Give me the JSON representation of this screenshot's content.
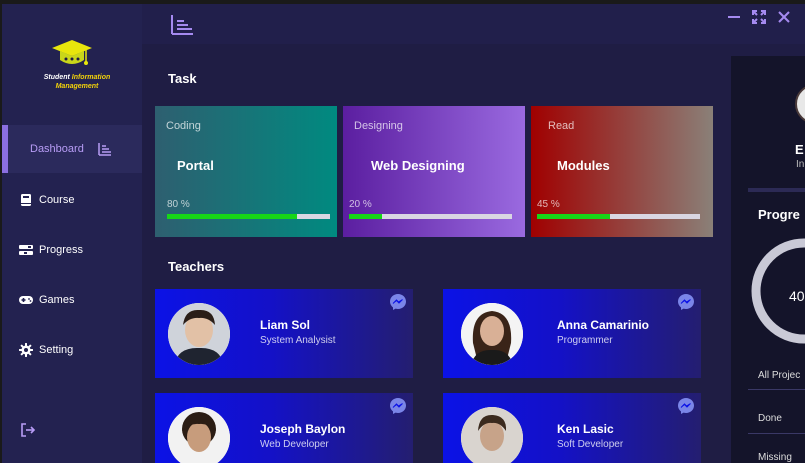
{
  "app": {
    "logo": {
      "line1_white": "Student ",
      "line1_yellow": "Information",
      "line2_yellow": "Management"
    }
  },
  "sidebar": {
    "items": [
      {
        "label": "Dashboard",
        "icon": "dashboard-list-icon",
        "active": true
      },
      {
        "label": "Course",
        "icon": "book-icon"
      },
      {
        "label": "Progress",
        "icon": "progress-icon"
      },
      {
        "label": "Games",
        "icon": "gamepad-icon"
      },
      {
        "label": "Setting",
        "icon": "gear-icon"
      }
    ],
    "logout_icon": "logout-icon"
  },
  "topbar": {
    "menu_icon": "menu-list-icon",
    "controls": [
      "minimize-icon",
      "fullscreen-icon",
      "close-icon"
    ]
  },
  "tasks": {
    "title": "Task",
    "cards": [
      {
        "category": "Coding",
        "name": "Portal",
        "progress_label": "80 %",
        "progress": 0.8
      },
      {
        "category": "Designing",
        "name": "Web Designing",
        "progress_label": "20 %",
        "progress": 0.2
      },
      {
        "category": "Read",
        "name": "Modules",
        "progress_label": "45 %",
        "progress": 0.45
      }
    ]
  },
  "teachers": {
    "title": "Teachers",
    "list": [
      {
        "name": "Liam Sol",
        "role": "System Analysist"
      },
      {
        "name": "Anna Camarinio",
        "role": "Programmer"
      },
      {
        "name": "Joseph Baylon",
        "role": "Web Developer"
      },
      {
        "name": "Ken Lasic",
        "role": "Soft Developer"
      }
    ],
    "message_icon": "messenger-icon"
  },
  "right_panel": {
    "initial": "E",
    "subtitle": "In",
    "title": "Progre",
    "ring_value": "40",
    "all_projects": "All Projec",
    "done": "Done",
    "missing": "Missing"
  },
  "colors": {
    "app_bg": "#1f1d44",
    "sidebar_bg": "#232250",
    "accent_purple": "#8b6fe0",
    "progress_green": "#17d617",
    "teacher_blue": "#0b12e6"
  }
}
